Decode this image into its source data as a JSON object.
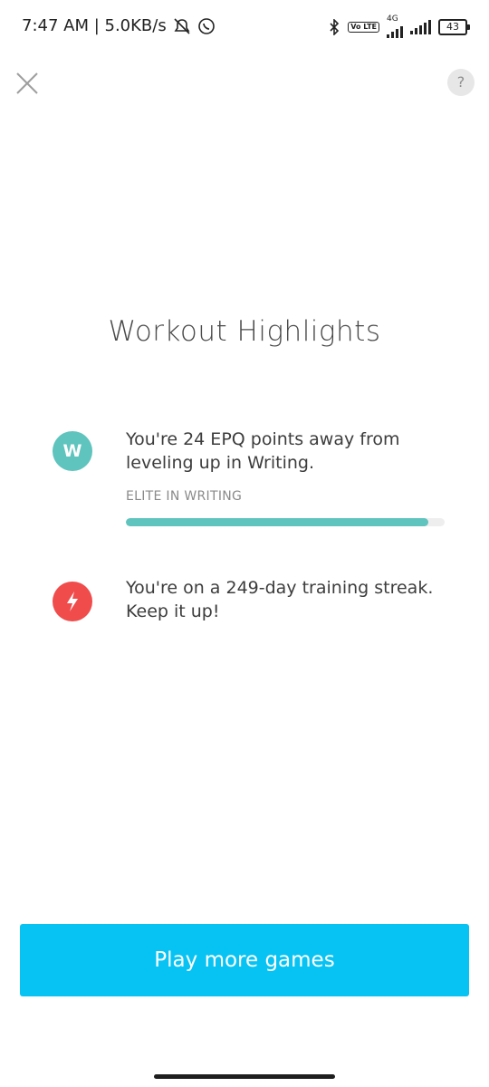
{
  "status": {
    "time_speed": "7:47 AM | 5.0KB/s",
    "network": "4G",
    "volte": "Vo LTE",
    "battery": "43"
  },
  "header": {
    "help_label": "?"
  },
  "title": "Workout Highlights",
  "highlights": [
    {
      "icon_letter": "W",
      "icon_color": "#5ec4bd",
      "text": "You're 24 EPQ points away from leveling up in Writing.",
      "sublabel": "ELITE IN WRITING",
      "progress": 0.95
    },
    {
      "icon_name": "lightning-icon",
      "icon_color": "#f04c4c",
      "text": "You're on a 249-day training streak. Keep it up!"
    }
  ],
  "cta": {
    "label": "Play more games",
    "color": "#06c3f4"
  }
}
